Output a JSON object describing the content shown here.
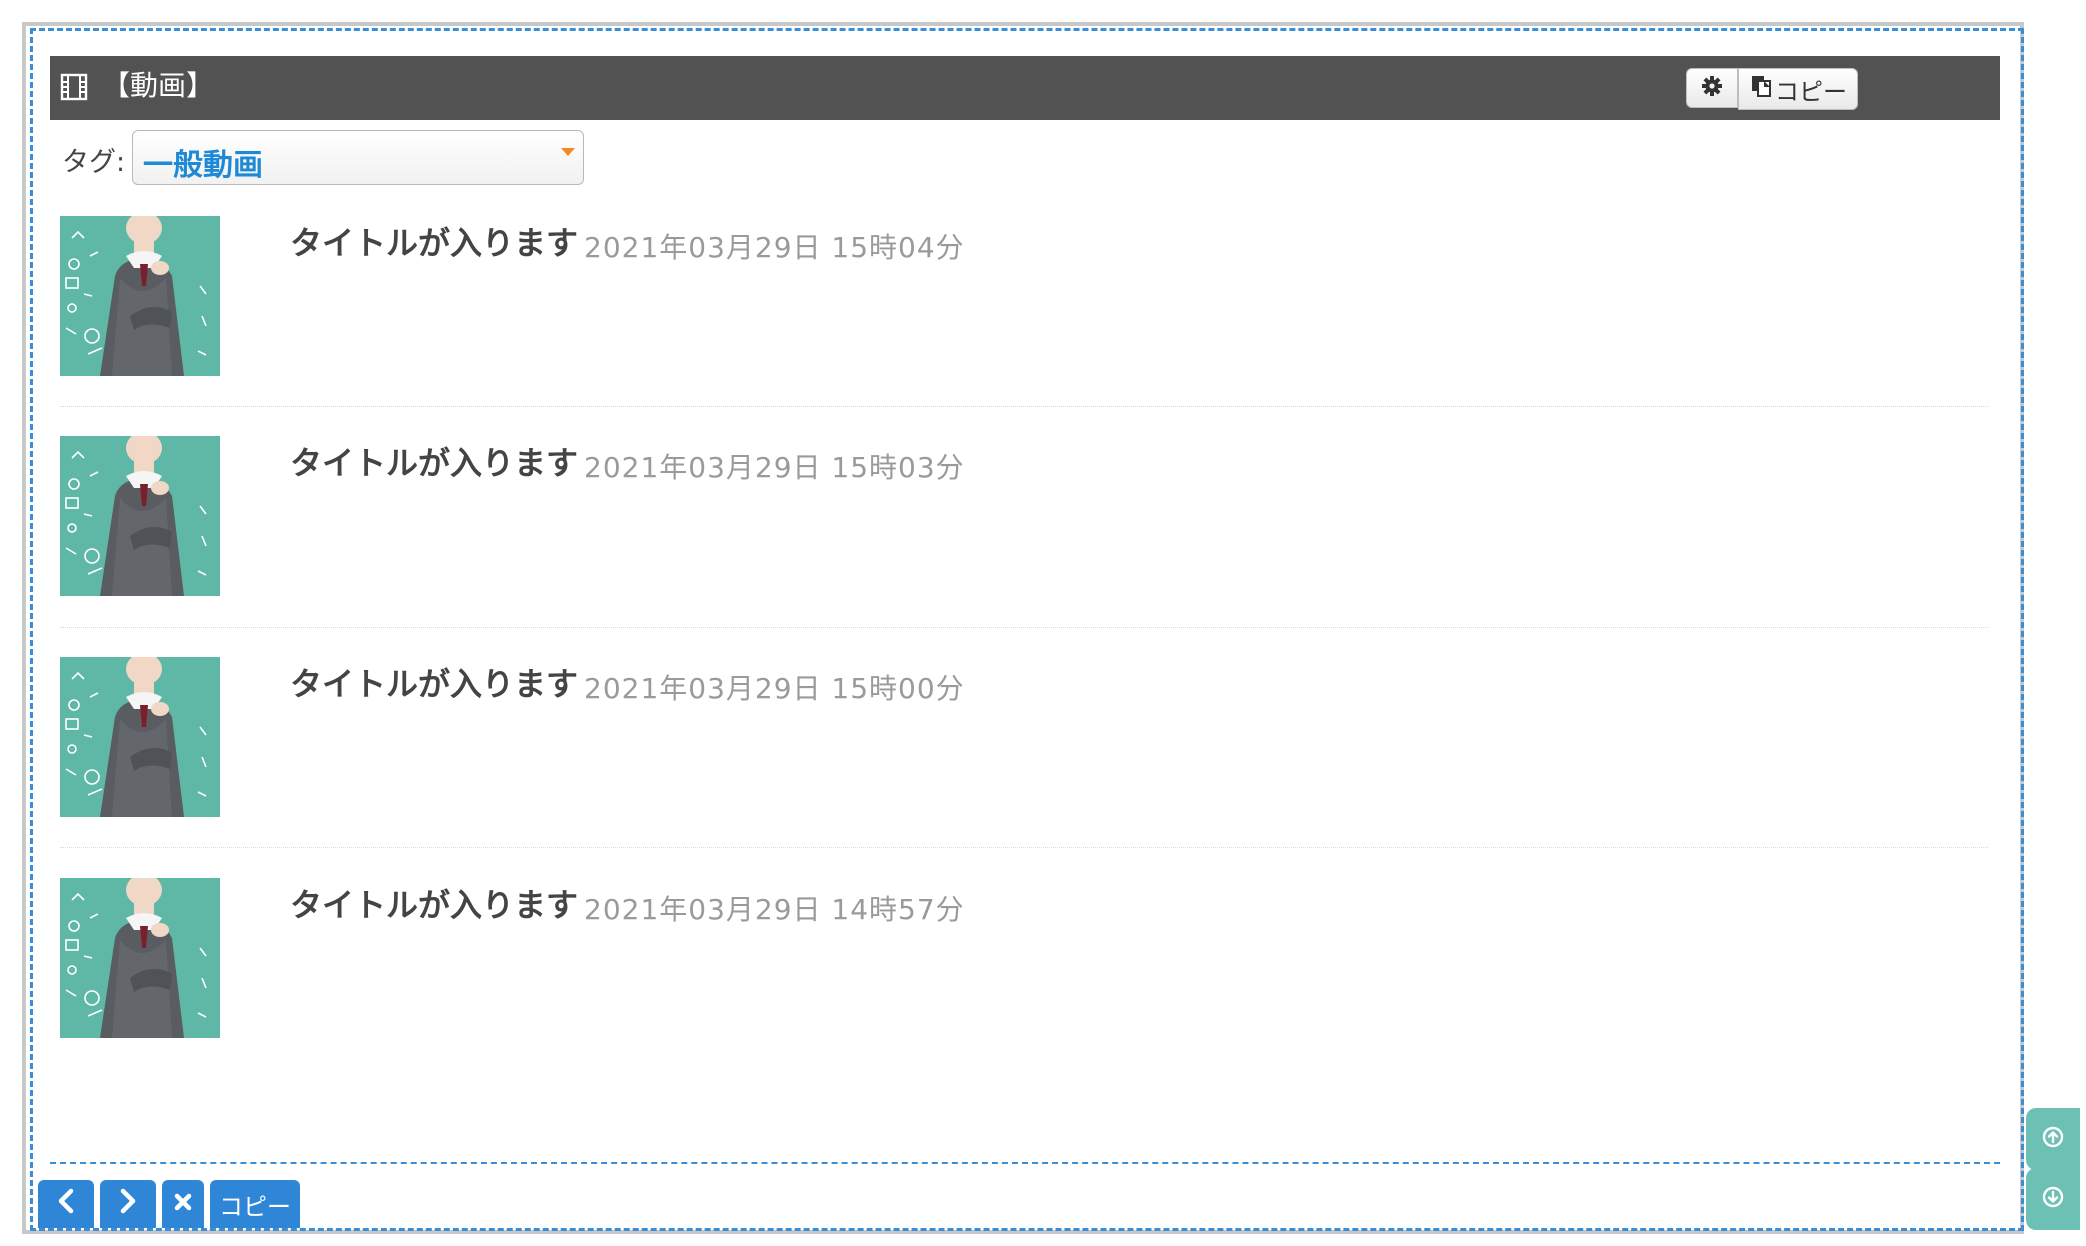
{
  "header": {
    "title": "【動画】",
    "copy_label": "コピー"
  },
  "tag": {
    "label": "タグ:",
    "selected": "一般動画"
  },
  "items": [
    {
      "title": "タイトルが入ります",
      "date": "2021年03月29日 15時04分"
    },
    {
      "title": "タイトルが入ります",
      "date": "2021年03月29日 15時03分"
    },
    {
      "title": "タイトルが入ります",
      "date": "2021年03月29日 15時00分"
    },
    {
      "title": "タイトルが入ります",
      "date": "2021年03月29日 14時57分"
    }
  ],
  "footer": {
    "copy_label": "コピー"
  },
  "icons": {
    "header": "film-icon",
    "settings": "gear-icon",
    "copy": "copy-icon",
    "prev": "chevron-left-icon",
    "next": "chevron-right-icon",
    "close": "close-icon",
    "scroll_up": "arrow-circle-up-icon",
    "scroll_down": "arrow-circle-down-icon"
  },
  "colors": {
    "header_bg": "#525252",
    "accent_blue": "#2f86d6",
    "tag_text": "#1e8ad6",
    "side_teal": "#6cc1b4",
    "thumb_teal": "#5fb8a6"
  }
}
